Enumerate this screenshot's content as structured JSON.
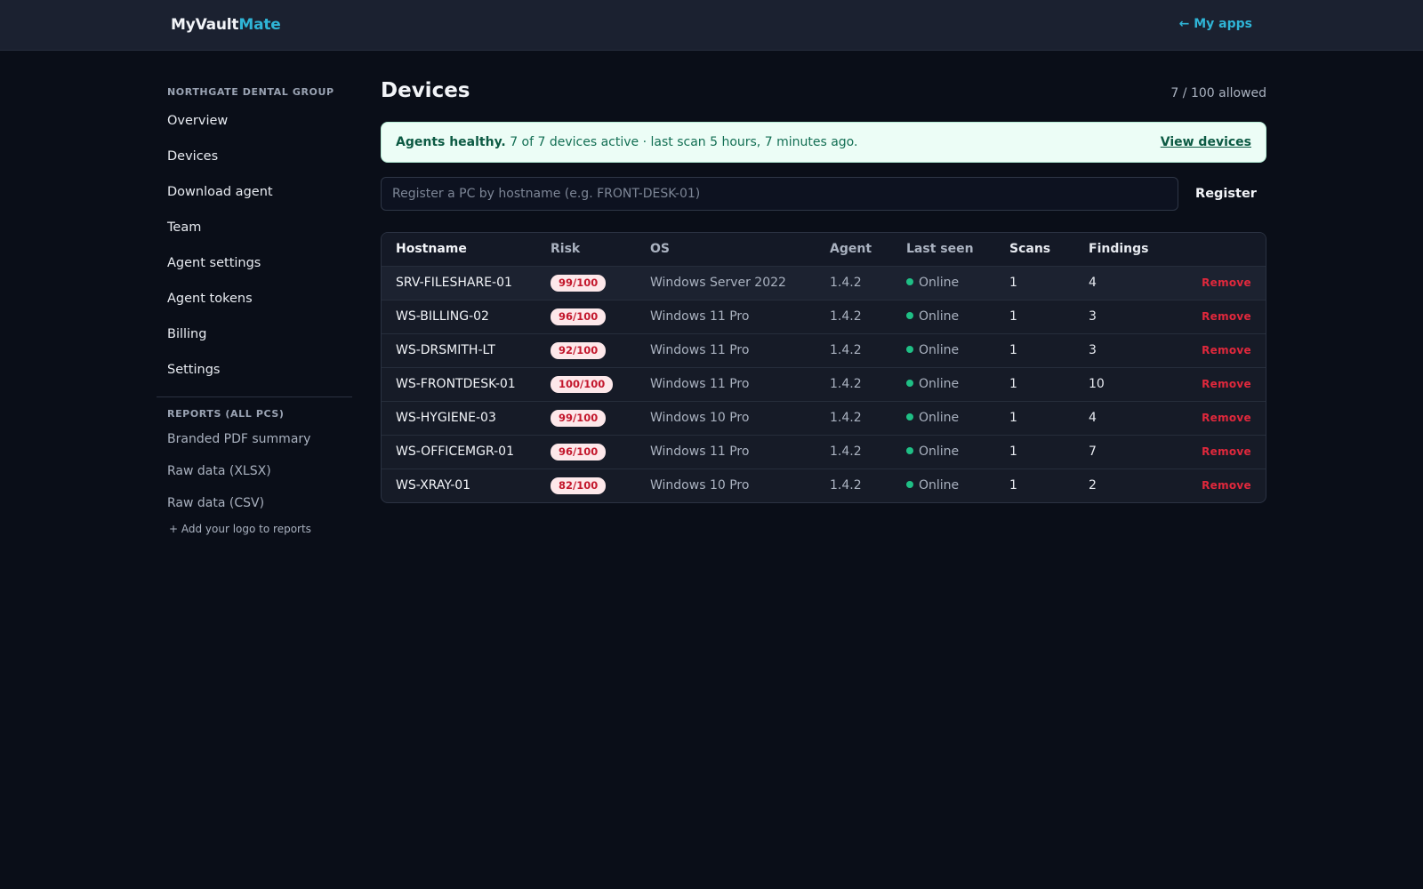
{
  "brand": {
    "part1": "MyVault",
    "part2": "Mate"
  },
  "header": {
    "my_apps": "← My apps"
  },
  "sidebar": {
    "org_name": "NORTHGATE DENTAL GROUP",
    "items": [
      {
        "label": "Overview"
      },
      {
        "label": "Devices"
      },
      {
        "label": "Download agent"
      },
      {
        "label": "Team"
      },
      {
        "label": "Agent settings"
      },
      {
        "label": "Agent tokens"
      },
      {
        "label": "Billing"
      },
      {
        "label": "Settings"
      }
    ],
    "reports_title": "REPORTS (ALL PCS)",
    "reports": [
      {
        "label": "Branded PDF summary"
      },
      {
        "label": "Raw data (XLSX)"
      },
      {
        "label": "Raw data (CSV)"
      }
    ],
    "add_logo": "+ Add your logo to reports"
  },
  "main": {
    "title": "Devices",
    "allowed": "7 / 100 allowed",
    "banner": {
      "strong": "Agents healthy.",
      "text": "7 of 7 devices active · last scan 5 hours, 7 minutes ago.",
      "link": "View devices"
    },
    "register": {
      "placeholder": "Register a PC by hostname (e.g. FRONT-DESK-01)",
      "button": "Register"
    },
    "table": {
      "headers": {
        "hostname": "Hostname",
        "risk": "Risk",
        "os": "OS",
        "agent": "Agent",
        "last_seen": "Last seen",
        "scans": "Scans",
        "findings": "Findings"
      },
      "rows": [
        {
          "hostname": "SRV-FILESHARE-01",
          "risk": "99/100",
          "os": "Windows Server 2022",
          "agent": "1.4.2",
          "last_seen": "Online",
          "scans": "1",
          "findings": "4",
          "action": "Remove"
        },
        {
          "hostname": "WS-BILLING-02",
          "risk": "96/100",
          "os": "Windows 11 Pro",
          "agent": "1.4.2",
          "last_seen": "Online",
          "scans": "1",
          "findings": "3",
          "action": "Remove"
        },
        {
          "hostname": "WS-DRSMITH-LT",
          "risk": "92/100",
          "os": "Windows 11 Pro",
          "agent": "1.4.2",
          "last_seen": "Online",
          "scans": "1",
          "findings": "3",
          "action": "Remove"
        },
        {
          "hostname": "WS-FRONTDESK-01",
          "risk": "100/100",
          "os": "Windows 11 Pro",
          "agent": "1.4.2",
          "last_seen": "Online",
          "scans": "1",
          "findings": "10",
          "action": "Remove"
        },
        {
          "hostname": "WS-HYGIENE-03",
          "risk": "99/100",
          "os": "Windows 10 Pro",
          "agent": "1.4.2",
          "last_seen": "Online",
          "scans": "1",
          "findings": "4",
          "action": "Remove"
        },
        {
          "hostname": "WS-OFFICEMGR-01",
          "risk": "96/100",
          "os": "Windows 11 Pro",
          "agent": "1.4.2",
          "last_seen": "Online",
          "scans": "1",
          "findings": "7",
          "action": "Remove"
        },
        {
          "hostname": "WS-XRAY-01",
          "risk": "82/100",
          "os": "Windows 10 Pro",
          "agent": "1.4.2",
          "last_seen": "Online",
          "scans": "1",
          "findings": "2",
          "action": "Remove"
        }
      ]
    }
  },
  "colors": {
    "accent": "#2fb4d6",
    "online": "#1fbf85",
    "danger": "#e0283c",
    "success_bg": "#ecfdf6"
  }
}
